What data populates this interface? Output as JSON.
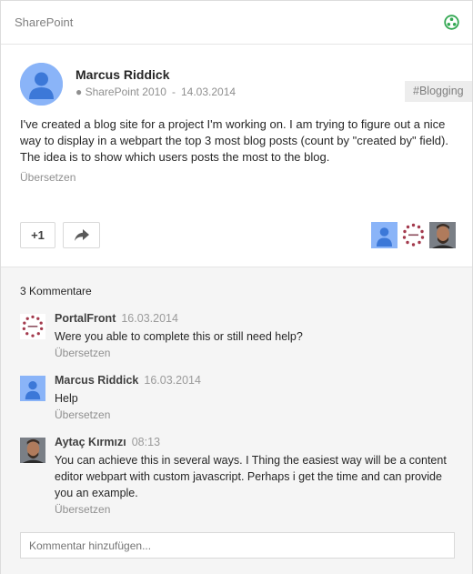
{
  "header": {
    "community": "SharePoint",
    "community_icon": "community-icon"
  },
  "post": {
    "author": "Marcus Riddick",
    "category": "● SharePoint 2010",
    "date": "14.03.2014",
    "tag": "#Blogging",
    "text": "I've created a blog site for a project I'm working on. I am trying to figure out a nice way to display in a webpart the top 3 most blog posts (count by \"created by\" field). The idea is to show which users posts the most to the blog.",
    "translate": "Übersetzen",
    "plus_label": "+1",
    "share_icon": "share-icon"
  },
  "comments_section": {
    "count_label": "3 Kommentare",
    "items": [
      {
        "author": "PortalFront",
        "time": "16.03.2014",
        "text": "Were you able to complete this or still need help?",
        "translate": "Übersetzen"
      },
      {
        "author": "Marcus Riddick",
        "time": "16.03.2014",
        "text": "Help",
        "translate": "Übersetzen"
      },
      {
        "author": "Aytaç Kırmızı",
        "time": "08:13",
        "text": "You can achieve this in several ways. I Thing the easiest way will be a content editor webpart with custom javascript. Perhaps i get the time and can provide you an example.",
        "translate": "Übersetzen"
      }
    ],
    "placeholder": "Kommentar hinzufügen..."
  },
  "colors": {
    "accent_green": "#34a853",
    "avatar_blue": "#8ab4f8",
    "avatar_dark_blue": "#3c78d8"
  }
}
